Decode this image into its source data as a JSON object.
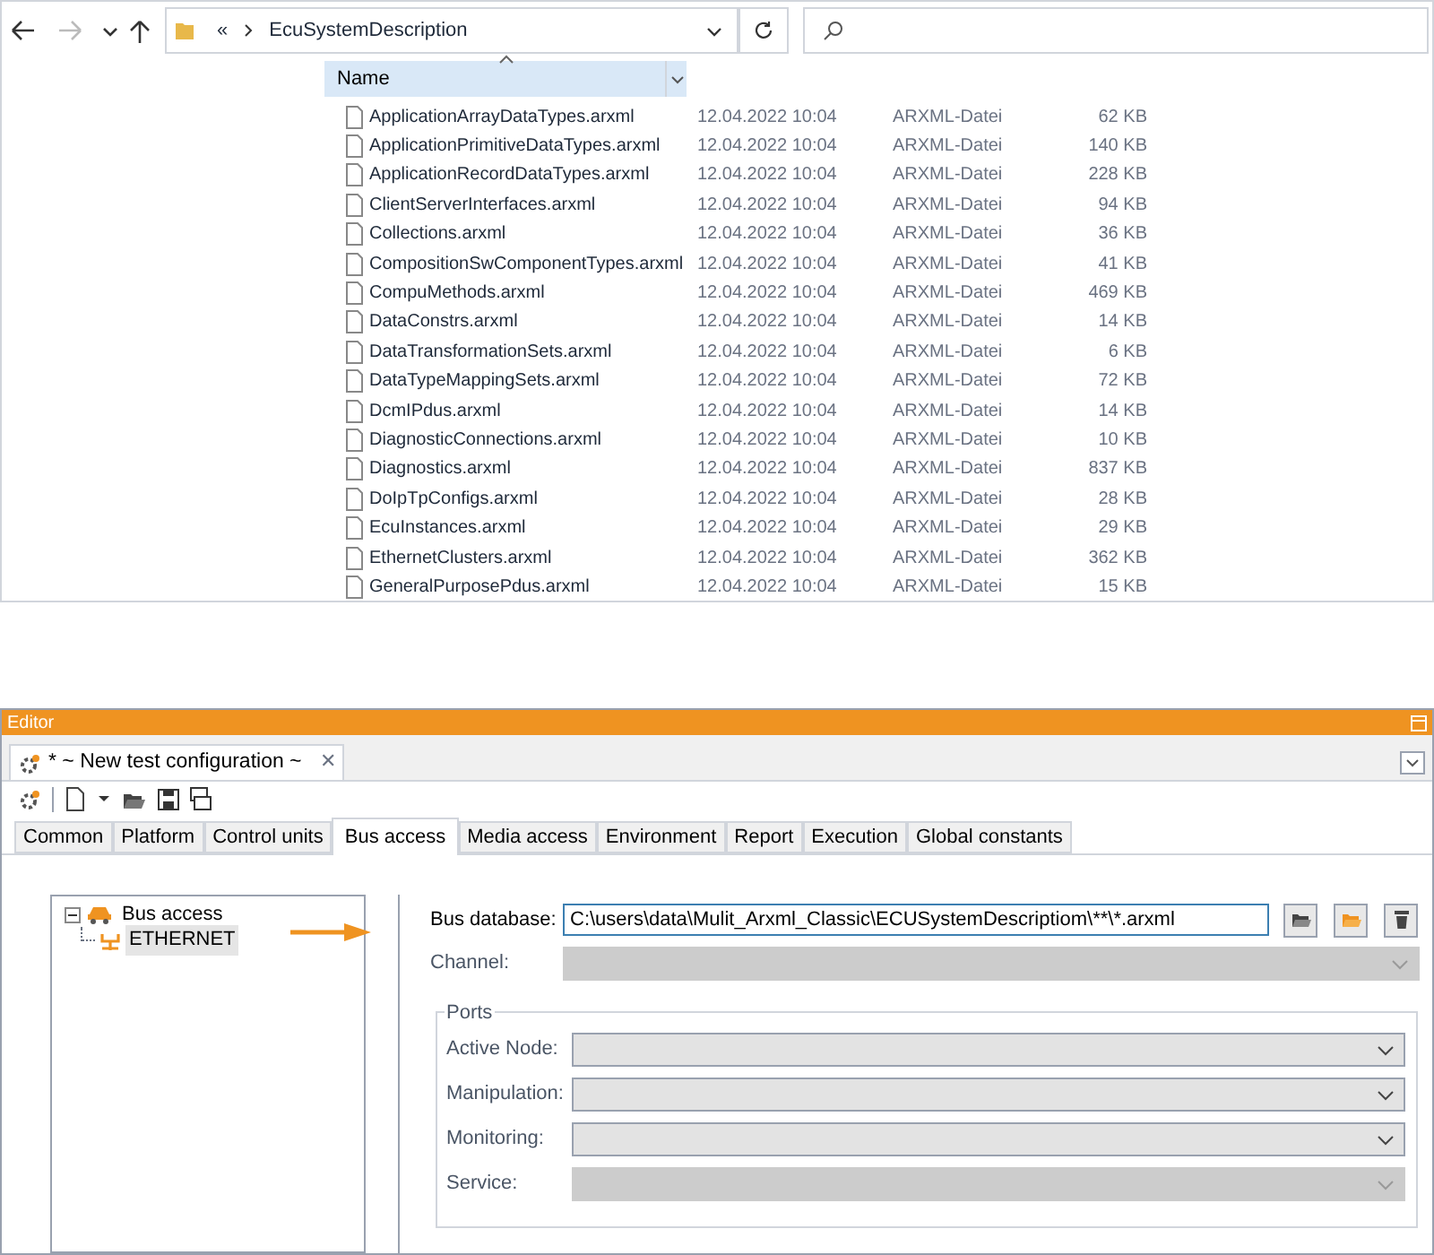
{
  "explorer": {
    "address": {
      "overflow": "«",
      "folder": "EcuSystemDescription"
    },
    "columns": [
      {
        "label": "Name",
        "sorted": true
      }
    ],
    "files": [
      {
        "name": "ApplicationArrayDataTypes.arxml",
        "date": "12.04.2022 10:04",
        "type": "ARXML-Datei",
        "size": "62 KB"
      },
      {
        "name": "ApplicationPrimitiveDataTypes.arxml",
        "date": "12.04.2022 10:04",
        "type": "ARXML-Datei",
        "size": "140 KB"
      },
      {
        "name": "ApplicationRecordDataTypes.arxml",
        "date": "12.04.2022 10:04",
        "type": "ARXML-Datei",
        "size": "228 KB"
      },
      {
        "name": "ClientServerInterfaces.arxml",
        "date": "12.04.2022 10:04",
        "type": "ARXML-Datei",
        "size": "94 KB"
      },
      {
        "name": "Collections.arxml",
        "date": "12.04.2022 10:04",
        "type": "ARXML-Datei",
        "size": "36 KB"
      },
      {
        "name": "CompositionSwComponentTypes.arxml",
        "date": "12.04.2022 10:04",
        "type": "ARXML-Datei",
        "size": "41 KB"
      },
      {
        "name": "CompuMethods.arxml",
        "date": "12.04.2022 10:04",
        "type": "ARXML-Datei",
        "size": "469 KB"
      },
      {
        "name": "DataConstrs.arxml",
        "date": "12.04.2022 10:04",
        "type": "ARXML-Datei",
        "size": "14 KB"
      },
      {
        "name": "DataTransformationSets.arxml",
        "date": "12.04.2022 10:04",
        "type": "ARXML-Datei",
        "size": "6 KB"
      },
      {
        "name": "DataTypeMappingSets.arxml",
        "date": "12.04.2022 10:04",
        "type": "ARXML-Datei",
        "size": "72 KB"
      },
      {
        "name": "DcmIPdus.arxml",
        "date": "12.04.2022 10:04",
        "type": "ARXML-Datei",
        "size": "14 KB"
      },
      {
        "name": "DiagnosticConnections.arxml",
        "date": "12.04.2022 10:04",
        "type": "ARXML-Datei",
        "size": "10 KB"
      },
      {
        "name": "Diagnostics.arxml",
        "date": "12.04.2022 10:04",
        "type": "ARXML-Datei",
        "size": "837 KB"
      },
      {
        "name": "DoIpTpConfigs.arxml",
        "date": "12.04.2022 10:04",
        "type": "ARXML-Datei",
        "size": "28 KB"
      },
      {
        "name": "EcuInstances.arxml",
        "date": "12.04.2022 10:04",
        "type": "ARXML-Datei",
        "size": "29 KB"
      },
      {
        "name": "EthernetClusters.arxml",
        "date": "12.04.2022 10:04",
        "type": "ARXML-Datei",
        "size": "362 KB"
      },
      {
        "name": "GeneralPurposePdus.arxml",
        "date": "12.04.2022 10:04",
        "type": "ARXML-Datei",
        "size": "15 KB"
      }
    ]
  },
  "editor": {
    "title": "Editor",
    "document_tab": {
      "label": "* ~ New test configuration ~",
      "close": "✕"
    },
    "tabs": [
      {
        "label": "Common",
        "selected": false
      },
      {
        "label": "Platform",
        "selected": false
      },
      {
        "label": "Control units",
        "selected": false
      },
      {
        "label": "Bus access",
        "selected": true
      },
      {
        "label": "Media access",
        "selected": false
      },
      {
        "label": "Environment",
        "selected": false
      },
      {
        "label": "Report",
        "selected": false
      },
      {
        "label": "Execution",
        "selected": false
      },
      {
        "label": "Global constants",
        "selected": false
      }
    ],
    "tree": [
      {
        "label": "Bus access",
        "expanded": true,
        "selected": false,
        "children": [
          {
            "label": "ETHERNET",
            "selected": true
          }
        ]
      }
    ],
    "bus_database": {
      "label": "Bus database:",
      "value": "C:\\users\\data\\Mulit_Arxml_Classic\\ECUSystemDescriptiom\\**\\*.arxml"
    },
    "channel": {
      "label": "Channel:",
      "disabled": true
    },
    "ports": {
      "title": "Ports",
      "fields": [
        {
          "label": "Active Node:",
          "disabled": false
        },
        {
          "label": "Manipulation:",
          "disabled": false
        },
        {
          "label": "Monitoring:",
          "disabled": false
        },
        {
          "label": "Service:",
          "disabled": true
        }
      ]
    }
  }
}
